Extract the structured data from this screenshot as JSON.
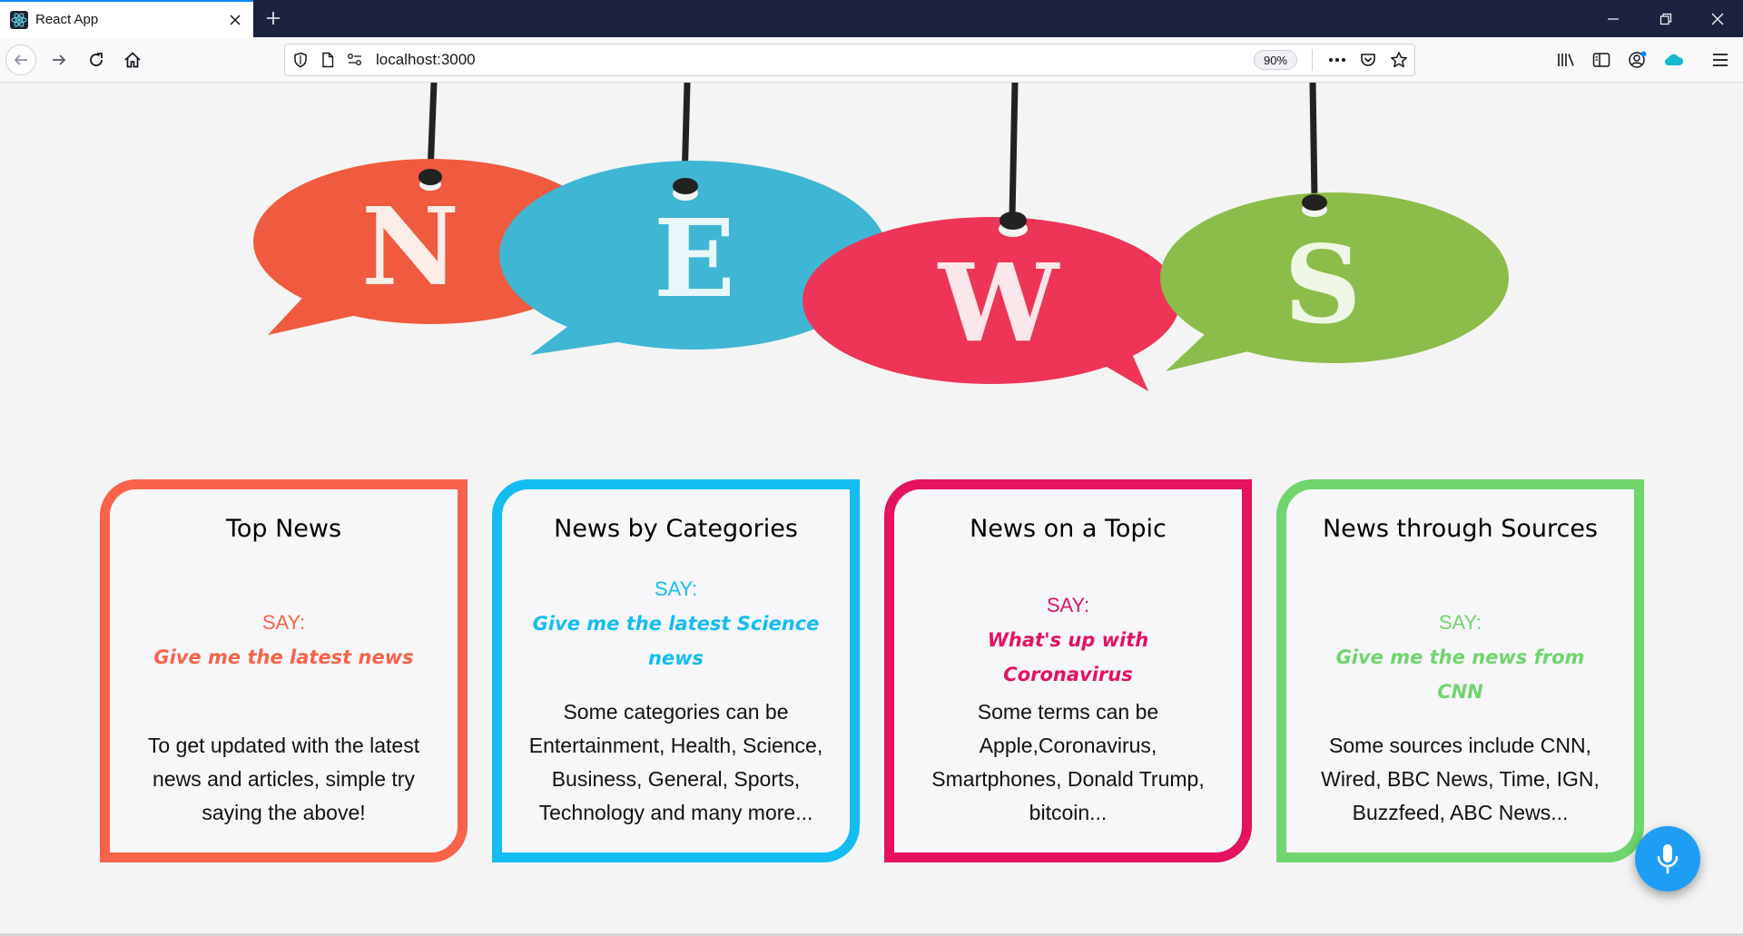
{
  "browser": {
    "tab_title": "React App",
    "url": "localhost:3000",
    "zoom": "90%"
  },
  "hero": {
    "letters": [
      "N",
      "E",
      "W",
      "S"
    ],
    "colors": [
      "#f05a3e",
      "#3fb6d3",
      "#ee3558",
      "#8cbc49"
    ]
  },
  "cards": [
    {
      "title": "Top News",
      "say": "SAY:",
      "phrase": "Give me the latest news",
      "description": "To get updated with the latest news and articles, simple try saying the above!",
      "color": "#f8634a"
    },
    {
      "title": "News by Categories",
      "say": "SAY:",
      "phrase": "Give me the latest Science news",
      "description": "Some categories can be Entertainment, Health, Science, Business, General, Sports, Technology and many more...",
      "color": "#13bdf2"
    },
    {
      "title": "News on a Topic",
      "say": "SAY:",
      "phrase": "What's up with Coronavirus",
      "description": "Some terms can be Apple,Coronavirus, Smartphones, Donald Trump, bitcoin...",
      "color": "#e4125f"
    },
    {
      "title": "News through Sources",
      "say": "SAY:",
      "phrase": "Give me the news from CNN",
      "description": "Some sources include CNN, Wired, BBC News, Time, IGN, Buzzfeed, ABC News...",
      "color": "#6fd56c"
    }
  ],
  "mic_button": {
    "icon": "microphone-icon"
  }
}
